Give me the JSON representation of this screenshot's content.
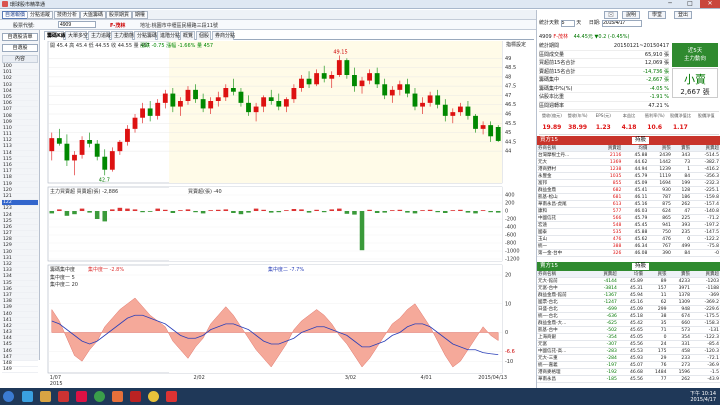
{
  "window": {
    "title": "環球股市精準通"
  },
  "window_controls": {
    "minimize": "─",
    "maximize": "□",
    "close": "✕"
  },
  "menu": {
    "tabs": [
      "自選報價",
      "分點追蹤",
      "技術分析",
      "大盤籌碼",
      "股票期貨",
      "期權"
    ],
    "active": 0,
    "right": {
      "user_label": "🖂",
      "btn1": "說明",
      "btn2": "學堂",
      "btn3": "登出"
    }
  },
  "toolbar": {
    "code_label": "股票代號:",
    "code_value": "4909",
    "stock_name": "F-茂林",
    "address": "地址:桃園市中壢區民權路三段11號"
  },
  "left": {
    "btn_top": "自選股清單",
    "btn_mid": "自選股",
    "col_header": "內容",
    "rows": [
      "100",
      "101",
      "102",
      "103",
      "104",
      "105",
      "106",
      "107",
      "108",
      "109",
      "110",
      "111",
      "112",
      "113",
      "114",
      "115",
      "116",
      "117",
      "118",
      "119",
      "120",
      "121",
      "122",
      "123",
      "124",
      "125",
      "126",
      "127",
      "128",
      "129",
      "130",
      "131",
      "132",
      "133",
      "134",
      "135",
      "136",
      "137",
      "138",
      "139",
      "140",
      "141",
      "142",
      "143",
      "144",
      "145",
      "146",
      "147",
      "148",
      "149"
    ],
    "selected_index": 22
  },
  "subtabs": {
    "items": [
      "籌碼K線",
      "大單多空",
      "主力追蹤",
      "主力動態",
      "分點籌碼",
      "進階分點",
      "概覽",
      "個股",
      "券商分點"
    ],
    "active": 0,
    "right_label": "指標設定"
  },
  "price_legend": {
    "items": [
      "開 45.4",
      "高 45.4",
      "低 44.55",
      "收 44.55",
      "量 457"
    ],
    "chg": "漲跌 -0.75",
    "chg_pct": "漲幅 -1.66%",
    "vol": "量 457"
  },
  "price_axis": {
    "ticks": [
      "49",
      "48.5",
      "48",
      "47.5",
      "47",
      "46.5",
      "46",
      "45.5",
      "45",
      "44.5",
      "44"
    ],
    "high_label": "49.15",
    "low_label": "42.7"
  },
  "volume_legend": {
    "title": "主力買賣超",
    "line1": "買賣超(張) -2,886",
    "line2": "買賣超(張) -40"
  },
  "volume_axis": {
    "ticks": [
      "400",
      "200",
      "0",
      "-200",
      "-400",
      "-600",
      "-800",
      "-1000",
      "-1200"
    ]
  },
  "osc_legend": {
    "title": "籌碼集中度",
    "line1": "集中度一 -2.8%",
    "line2": "集中度二 -7.7%",
    "param1_label": "集中度一",
    "param1_value": "5",
    "param2_label": "集中度二",
    "param2_value": "20"
  },
  "osc_axis": {
    "ticks": [
      "20",
      "10",
      "0",
      "-6.6",
      "-10"
    ]
  },
  "date_axis": {
    "labels": [
      "1/07\n2015",
      "2/02",
      "3/02",
      "4/01",
      "2015/04/13"
    ]
  },
  "chart_data": {
    "type": "candlestick",
    "title": "",
    "candles": [
      [
        44.0,
        45.0,
        43.5,
        44.7
      ],
      [
        44.7,
        45.2,
        44.3,
        44.4
      ],
      [
        44.4,
        44.9,
        43.2,
        43.5
      ],
      [
        43.5,
        44.0,
        42.7,
        43.8
      ],
      [
        43.8,
        44.8,
        43.6,
        44.6
      ],
      [
        44.6,
        45.0,
        44.2,
        44.4
      ],
      [
        44.4,
        44.6,
        43.5,
        43.7
      ],
      [
        43.7,
        44.1,
        42.7,
        43.0
      ],
      [
        43.0,
        44.2,
        42.9,
        44.0
      ],
      [
        44.0,
        44.6,
        43.8,
        44.5
      ],
      [
        44.5,
        45.4,
        44.3,
        45.2
      ],
      [
        45.2,
        46.0,
        45.0,
        45.8
      ],
      [
        45.8,
        46.6,
        45.5,
        46.3
      ],
      [
        46.3,
        46.7,
        45.6,
        45.9
      ],
      [
        45.9,
        46.8,
        45.7,
        46.6
      ],
      [
        46.6,
        47.3,
        46.3,
        47.1
      ],
      [
        47.1,
        47.4,
        46.1,
        46.4
      ],
      [
        46.4,
        46.9,
        45.9,
        46.7
      ],
      [
        46.7,
        47.5,
        46.5,
        47.3
      ],
      [
        47.3,
        47.6,
        46.6,
        46.8
      ],
      [
        46.8,
        47.1,
        46.1,
        46.3
      ],
      [
        46.3,
        46.9,
        46.0,
        46.7
      ],
      [
        46.7,
        47.2,
        46.4,
        46.9
      ],
      [
        46.9,
        47.6,
        46.7,
        47.4
      ],
      [
        47.4,
        47.9,
        47.0,
        47.2
      ],
      [
        47.2,
        47.4,
        46.4,
        46.6
      ],
      [
        46.6,
        47.0,
        45.9,
        46.1
      ],
      [
        46.1,
        46.6,
        45.6,
        46.4
      ],
      [
        46.4,
        47.0,
        46.1,
        46.9
      ],
      [
        46.9,
        47.3,
        46.5,
        46.7
      ],
      [
        46.7,
        47.1,
        46.2,
        46.4
      ],
      [
        46.4,
        46.9,
        46.1,
        46.8
      ],
      [
        46.8,
        47.6,
        46.6,
        47.4
      ],
      [
        47.4,
        48.1,
        47.2,
        47.9
      ],
      [
        47.9,
        48.3,
        47.4,
        47.6
      ],
      [
        47.6,
        48.4,
        47.5,
        48.2
      ],
      [
        48.2,
        48.6,
        47.7,
        47.9
      ],
      [
        47.9,
        48.3,
        47.4,
        48.1
      ],
      [
        48.1,
        49.15,
        48.0,
        48.9
      ],
      [
        48.9,
        49.0,
        47.9,
        48.1
      ],
      [
        48.1,
        48.5,
        47.2,
        47.5
      ],
      [
        47.5,
        48.0,
        47.1,
        47.8
      ],
      [
        47.8,
        48.4,
        47.6,
        48.2
      ],
      [
        48.2,
        48.5,
        47.4,
        47.6
      ],
      [
        47.6,
        47.9,
        46.8,
        47.0
      ],
      [
        47.0,
        47.5,
        46.6,
        47.3
      ],
      [
        47.3,
        47.8,
        47.0,
        47.6
      ],
      [
        47.6,
        47.9,
        46.9,
        47.1
      ],
      [
        47.1,
        47.4,
        46.2,
        46.4
      ],
      [
        46.4,
        46.9,
        46.0,
        46.6
      ],
      [
        46.6,
        47.2,
        46.4,
        47.0
      ],
      [
        47.0,
        47.3,
        46.3,
        46.5
      ],
      [
        46.5,
        46.8,
        45.6,
        45.9
      ],
      [
        45.9,
        46.3,
        45.5,
        46.1
      ],
      [
        46.1,
        46.6,
        45.9,
        46.4
      ],
      [
        46.4,
        46.7,
        45.7,
        45.9
      ],
      [
        45.9,
        46.0,
        45.0,
        45.2
      ],
      [
        45.2,
        45.6,
        44.9,
        45.4
      ],
      [
        45.4,
        45.6,
        44.5,
        44.8
      ],
      [
        45.3,
        45.4,
        44.5,
        44.55
      ]
    ],
    "ylim": [
      42.5,
      49.5
    ],
    "volume": [
      -60,
      40,
      -120,
      -80,
      60,
      -40,
      -200,
      -260,
      40,
      80,
      60,
      40,
      -30,
      -20,
      60,
      30,
      -50,
      20,
      40,
      -30,
      -60,
      20,
      30,
      40,
      -50,
      -80,
      -40,
      60,
      30,
      -40,
      -30,
      20,
      50,
      40,
      -40,
      30,
      -30,
      40,
      60,
      -70,
      -90,
      -980,
      30,
      -50,
      -40,
      20,
      30,
      -40,
      -60,
      20,
      30,
      -30,
      -50,
      20,
      30,
      -40,
      -60,
      20,
      -30,
      -40
    ],
    "volume_ylim": [
      -1200,
      400
    ],
    "conc1": [
      8,
      4,
      -2,
      -8,
      -10,
      -6,
      -3,
      2,
      5,
      8,
      10,
      12,
      9,
      6,
      4,
      2,
      -3,
      -6,
      -9,
      -5,
      -2,
      3,
      6,
      9,
      6,
      2,
      -2,
      -6,
      -9,
      -12,
      -8,
      -4,
      1,
      4,
      6,
      8,
      6,
      3,
      -1,
      -4,
      -8,
      -12,
      -9,
      -5,
      -1,
      3,
      5,
      8,
      10,
      6,
      2,
      -3,
      -8,
      -12,
      -10,
      -6,
      -2,
      2,
      -1,
      -2.8
    ],
    "conc2": [
      4,
      3,
      1,
      -1,
      -3,
      -4,
      -3,
      -1,
      1,
      3,
      5,
      6,
      6,
      5,
      4,
      3,
      1,
      -1,
      -2,
      -2,
      -1,
      1,
      2,
      3,
      3,
      2,
      1,
      -1,
      -3,
      -4,
      -4,
      -3,
      -2,
      0,
      1,
      2,
      2,
      1,
      0,
      -1,
      -3,
      -5,
      -5,
      -4,
      -3,
      -1,
      0,
      2,
      3,
      3,
      2,
      0,
      -2,
      -4,
      -5,
      -6,
      -6,
      -7,
      -7.4,
      -7.7
    ],
    "osc_ylim": [
      -12,
      20
    ]
  },
  "right": {
    "header": {
      "date_label": "統計天數",
      "days": "5",
      "day_unit": "天",
      "date_to_label": "日期:",
      "date_value": "2015/4/17"
    },
    "stock": {
      "code": "4909",
      "name": "F-茂林",
      "price": "44.45元",
      "change": "▼0.2 (-0.45%)"
    },
    "stats": [
      {
        "label": "統計期間",
        "value": "20150121~20150417"
      },
      {
        "label": "區間成交量",
        "value": "65,910 張"
      },
      {
        "label": "買超前15名合計",
        "value": "12,069 張"
      },
      {
        "label": "賣超前15名合計",
        "value": "-14,736 張"
      },
      {
        "label": "籌碼集中",
        "value": "-2,667 張"
      },
      {
        "label": "籌碼集中%(%)",
        "value": "-4.05 %"
      },
      {
        "label": "佔股本比重",
        "value": "-1.91 %"
      },
      {
        "label": "區間週轉率",
        "value": "47.21 %"
      }
    ],
    "badge": {
      "line1": "近5天",
      "line2": "主力動向",
      "big": "小賣",
      "amount": "2,667 張"
    },
    "metrics": {
      "headers": [
        "營收(億元)",
        "營收(年%)",
        "EPS(元)",
        "本益比",
        "殖利率(%)",
        "股價淨值比",
        "股價淨值"
      ],
      "values": [
        "19.89",
        "38.99",
        "1.23",
        "4.18",
        "10.6",
        "1.17",
        ""
      ]
    },
    "buy": {
      "title": "買方15",
      "filter": "持股",
      "tbl_headers": [
        "券商名稱",
        "買賣超",
        "均價",
        "買張",
        "賣張",
        "買賣超"
      ],
      "rows": [
        [
          "台灣摩根士丹...",
          "2116",
          "45.88",
          "2439",
          "343",
          "2083",
          "-514.5"
        ],
        [
          "元大",
          "1369",
          "44.62",
          "1442",
          "73",
          "1515",
          "-382.7"
        ],
        [
          "港商野村",
          "1238",
          "44.94",
          "1239",
          "1",
          "1240",
          "-416.2"
        ],
        [
          "永豐金",
          "1035",
          "45.79",
          "1119",
          "84",
          "1293",
          "-356.3"
        ],
        [
          "富邦",
          "855",
          "45.09",
          "1694",
          "199",
          "1253",
          "-232.3"
        ],
        [
          "群益金鼎",
          "682",
          "45.41",
          "930",
          "128",
          "1056",
          "-225.1"
        ],
        [
          "凱基-松山",
          "681",
          "46.11",
          "787",
          "186",
          "693",
          "-159.8"
        ],
        [
          "華南永昌-虎尾",
          "613",
          "45.16",
          "875",
          "262",
          "1137",
          "-157.4"
        ],
        [
          "康和",
          "577",
          "46.03",
          "624",
          "47",
          "671",
          "-140.8"
        ],
        [
          "中國信託",
          "566",
          "45.79",
          "865",
          "225",
          "1201",
          "-71.2"
        ],
        [
          "宏遠",
          "548",
          "45.45",
          "941",
          "393",
          "1334",
          "-197.2"
        ],
        [
          "國泰",
          "535",
          "45.88",
          "750",
          "235",
          "985",
          "-147.5"
        ],
        [
          "玉山",
          "476",
          "45.62",
          "476",
          "0",
          "476",
          "-122.2"
        ],
        [
          "統一",
          "388",
          "46.34",
          "767",
          "499",
          "1176",
          "-75.8"
        ],
        [
          "第一金-台中",
          "326",
          "46.08",
          "390",
          "84",
          "434",
          "-0"
        ]
      ]
    },
    "sell": {
      "title": "賣方15",
      "filter": "持股",
      "tbl_headers": [
        "券商名稱",
        "買賣超",
        "均價",
        "買張",
        "賣張",
        "買賣超"
      ],
      "rows": [
        [
          "元大-館前",
          "-4144",
          "45.89",
          "89",
          "4233",
          "4322",
          "-1203"
        ],
        [
          "元富-台中",
          "-3814",
          "45.31",
          "157",
          "3971",
          "4128",
          "-1188"
        ],
        [
          "群益金鼎-館前",
          "-1367",
          "45.94",
          "11",
          "1378",
          "1389",
          "-369"
        ],
        [
          "國票-台北",
          "-1247",
          "45.16",
          "62",
          "1309",
          "1371",
          "-369.2"
        ],
        [
          "日盛-台北",
          "-699",
          "45.09",
          "299",
          "948",
          "1267",
          "-229.6"
        ],
        [
          "統一-台北",
          "-636",
          "45.18",
          "38",
          "674",
          "712",
          "-175.5"
        ],
        [
          "群益金鼎-大...",
          "-625",
          "45.42",
          "35",
          "660",
          "695",
          "-158.3"
        ],
        [
          "凱基-台中",
          "-502",
          "45.65",
          "71",
          "573",
          "644",
          "-131"
        ],
        [
          "上海商銀",
          "-354",
          "45.05",
          "0",
          "354",
          "354",
          "-122.3"
        ],
        [
          "元富",
          "-307",
          "45.56",
          "24",
          "331",
          "355",
          "-85.4"
        ],
        [
          "中國信託-高...",
          "-283",
          "45.53",
          "175",
          "458",
          "633",
          "-120.3"
        ],
        [
          "元大-三重",
          "-284",
          "45.93",
          "29",
          "233",
          "262",
          "-72.1"
        ],
        [
          "統一-嘉義",
          "-197",
          "45.07",
          "76",
          "273",
          "349",
          "-36.9"
        ],
        [
          "港商麥格理",
          "-192",
          "46.68",
          "1484",
          "1596",
          "3080",
          "-1.5"
        ],
        [
          "華南永昌",
          "-185",
          "45.56",
          "77",
          "262",
          "339",
          "-43.9"
        ]
      ]
    }
  },
  "taskbar": {
    "time": "下午 10:14",
    "date": "2015/4/17"
  }
}
